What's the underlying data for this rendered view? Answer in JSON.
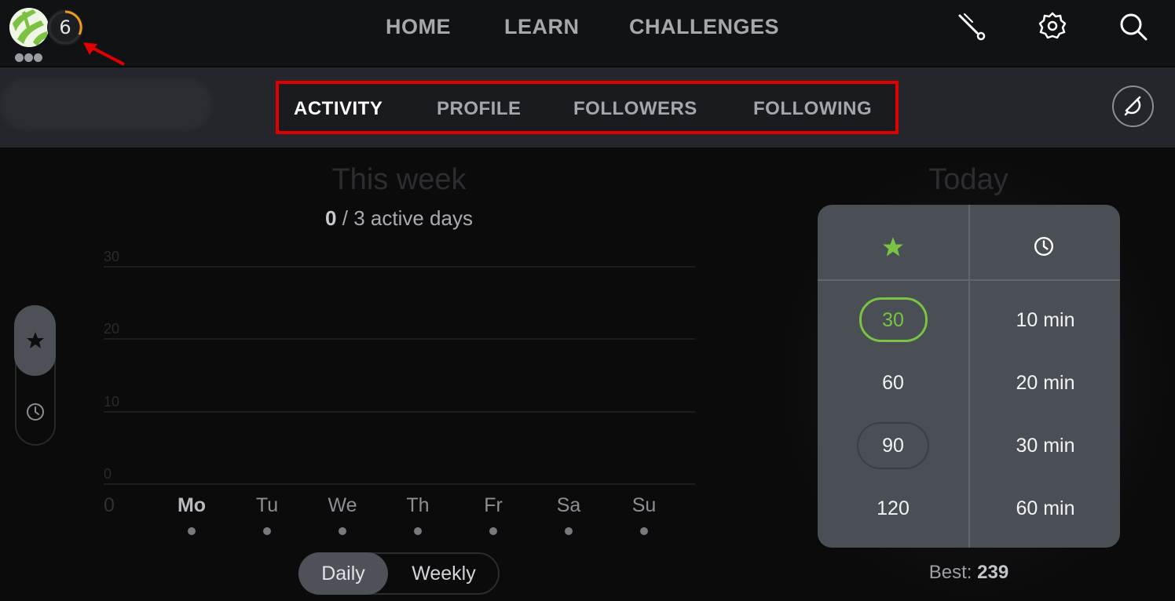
{
  "topbar": {
    "level_number": "6",
    "nav": [
      "HOME",
      "LEARN",
      "CHALLENGES"
    ],
    "icons": [
      "brush-icon",
      "gear-icon",
      "search-icon"
    ]
  },
  "subnav": {
    "tabs": [
      "ACTIVITY",
      "PROFILE",
      "FOLLOWERS",
      "FOLLOWING"
    ],
    "active_tab": "ACTIVITY",
    "notification_icon": "bell-icon"
  },
  "week": {
    "title": "This week",
    "active_count": "0",
    "active_rest": "/ 3 active days",
    "metric_toggle": [
      "star-icon",
      "clock-icon"
    ]
  },
  "chart_data": {
    "type": "bar",
    "categories": [
      "Mo",
      "Tu",
      "We",
      "Th",
      "Fr",
      "Sa",
      "Su"
    ],
    "values": [
      0,
      0,
      0,
      0,
      0,
      0,
      0
    ],
    "yticks": [
      "30",
      "20",
      "10",
      "0"
    ],
    "ylim": [
      0,
      30
    ],
    "cut_label": "0",
    "highlighted": "Mo"
  },
  "period_toggle": {
    "daily": "Daily",
    "weekly": "Weekly",
    "selected": "Daily"
  },
  "today": {
    "title": "Today",
    "xp_options": [
      "30",
      "60",
      "90",
      "120"
    ],
    "xp_selected": "30",
    "time_options": [
      "10 min",
      "20 min",
      "30 min",
      "60 min"
    ],
    "best_label": "Best:",
    "best_value": "239"
  },
  "colors": {
    "accent_green": "#79c443",
    "annotation_red": "#e00000",
    "level_ring_orange": "#f39a1e"
  }
}
